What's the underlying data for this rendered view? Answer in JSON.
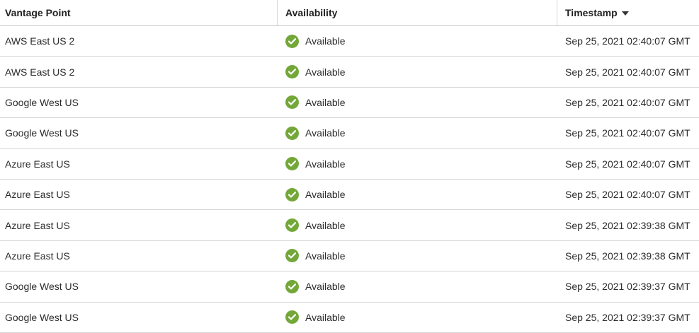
{
  "colors": {
    "available_green": "#73a839"
  },
  "table": {
    "headers": {
      "vantage_point": "Vantage Point",
      "availability": "Availability",
      "timestamp": "Timestamp",
      "sort_icon": "caret-down-icon"
    },
    "rows": [
      {
        "vantage_point": "AWS East US 2",
        "availability": "Available",
        "timestamp": "Sep 25, 2021 02:40:07 GMT"
      },
      {
        "vantage_point": "AWS East US 2",
        "availability": "Available",
        "timestamp": "Sep 25, 2021 02:40:07 GMT"
      },
      {
        "vantage_point": "Google West US",
        "availability": "Available",
        "timestamp": "Sep 25, 2021 02:40:07 GMT"
      },
      {
        "vantage_point": "Google West US",
        "availability": "Available",
        "timestamp": "Sep 25, 2021 02:40:07 GMT"
      },
      {
        "vantage_point": "Azure East US",
        "availability": "Available",
        "timestamp": "Sep 25, 2021 02:40:07 GMT"
      },
      {
        "vantage_point": "Azure East US",
        "availability": "Available",
        "timestamp": "Sep 25, 2021 02:40:07 GMT"
      },
      {
        "vantage_point": "Azure East US",
        "availability": "Available",
        "timestamp": "Sep 25, 2021 02:39:38 GMT"
      },
      {
        "vantage_point": "Azure East US",
        "availability": "Available",
        "timestamp": "Sep 25, 2021 02:39:38 GMT"
      },
      {
        "vantage_point": "Google West US",
        "availability": "Available",
        "timestamp": "Sep 25, 2021 02:39:37 GMT"
      },
      {
        "vantage_point": "Google West US",
        "availability": "Available",
        "timestamp": "Sep 25, 2021 02:39:37 GMT"
      }
    ]
  }
}
